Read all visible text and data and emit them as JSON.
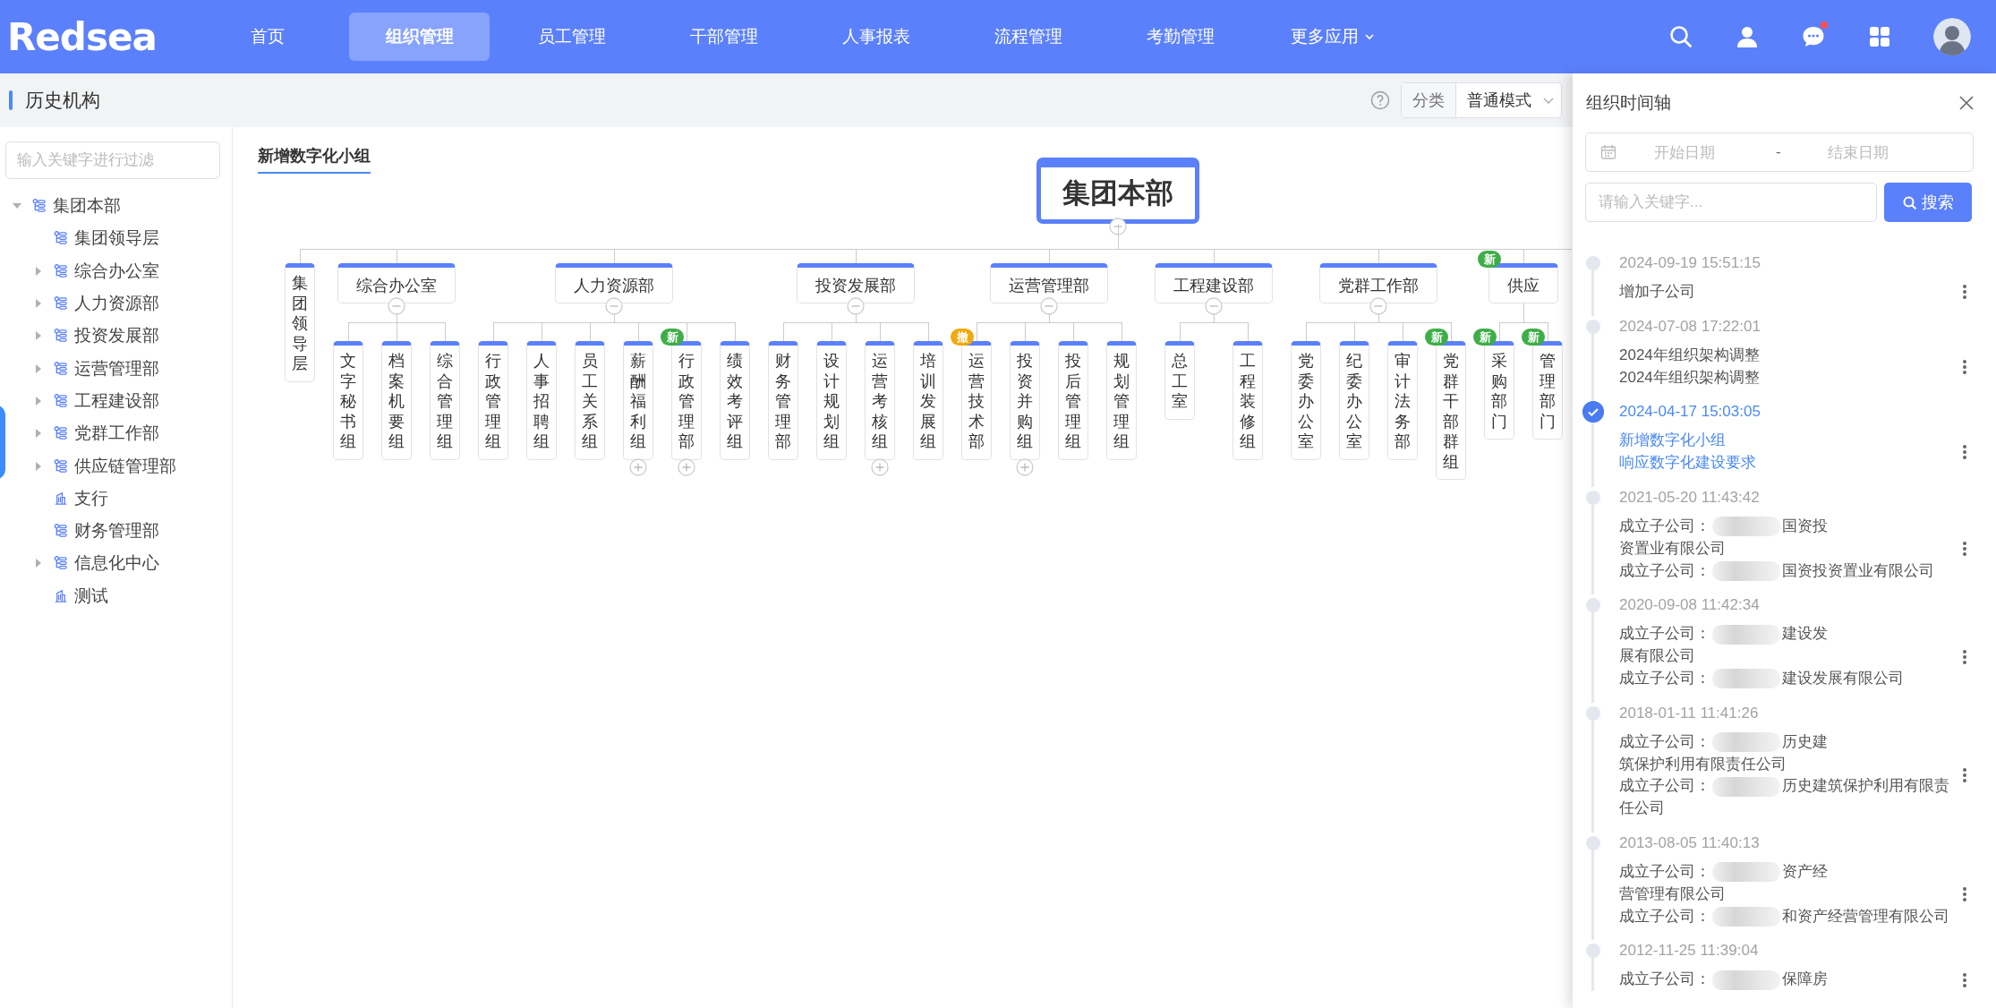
{
  "header": {
    "logo": "Redsea",
    "nav": [
      {
        "label": "首页",
        "selected": false,
        "has_menu": false
      },
      {
        "label": "组织管理",
        "selected": true,
        "has_menu": false
      },
      {
        "label": "员工管理",
        "selected": false,
        "has_menu": false
      },
      {
        "label": "干部管理",
        "selected": false,
        "has_menu": false
      },
      {
        "label": "人事报表",
        "selected": false,
        "has_menu": false
      },
      {
        "label": "流程管理",
        "selected": false,
        "has_menu": false
      },
      {
        "label": "考勤管理",
        "selected": false,
        "has_menu": false
      },
      {
        "label": "更多应用",
        "selected": false,
        "has_menu": true
      }
    ],
    "chat_unread": true
  },
  "page_title": "历史机构",
  "category": {
    "label": "分类",
    "value": "普通模式"
  },
  "sidebar": {
    "filter_placeholder": "输入关键字进行过滤",
    "tree": [
      {
        "label": "集团本部",
        "kind": "org",
        "expandable": true,
        "expanded": true,
        "children": [
          {
            "label": "集团领导层",
            "kind": "org",
            "expandable": false
          },
          {
            "label": "综合办公室",
            "kind": "org",
            "expandable": true,
            "expanded": false
          },
          {
            "label": "人力资源部",
            "kind": "org",
            "expandable": true,
            "expanded": false
          },
          {
            "label": "投资发展部",
            "kind": "org",
            "expandable": true,
            "expanded": false
          },
          {
            "label": "运营管理部",
            "kind": "org",
            "expandable": true,
            "expanded": false
          },
          {
            "label": "工程建设部",
            "kind": "org",
            "expandable": true,
            "expanded": false
          },
          {
            "label": "党群工作部",
            "kind": "org",
            "expandable": true,
            "expanded": false
          },
          {
            "label": "供应链管理部",
            "kind": "org",
            "expandable": true,
            "expanded": false
          },
          {
            "label": "支行",
            "kind": "branch",
            "expandable": false
          },
          {
            "label": "财务管理部",
            "kind": "org",
            "expandable": false
          },
          {
            "label": "信息化中心",
            "kind": "org",
            "expandable": true,
            "expanded": false
          },
          {
            "label": "测试",
            "kind": "branch",
            "expandable": false
          }
        ]
      }
    ]
  },
  "chart": {
    "title": "新增数字化小组",
    "root": {
      "label": "集团本部",
      "expandable": true,
      "expanded": true,
      "children": [
        {
          "label": "集团领导层",
          "expandable": false,
          "expanded": false
        },
        {
          "label": "综合办公室",
          "expandable": true,
          "expanded": true,
          "children": [
            {
              "label": "文字秘书组",
              "expandable": false,
              "expanded": false
            },
            {
              "label": "档案机要组",
              "expandable": false,
              "expanded": false
            },
            {
              "label": "综合管理组",
              "expandable": false,
              "expanded": false
            }
          ]
        },
        {
          "label": "人力资源部",
          "expandable": true,
          "expanded": true,
          "children": [
            {
              "label": "行政管理组",
              "expandable": false,
              "expanded": false
            },
            {
              "label": "人事招聘组",
              "expandable": false,
              "expanded": false
            },
            {
              "label": "员工关系组",
              "expandable": false,
              "expanded": false
            },
            {
              "label": "薪酬福利组",
              "expandable": true,
              "expanded": false
            },
            {
              "label": "行政管理部",
              "expandable": true,
              "expanded": false,
              "badge": {
                "text": "新",
                "kind": "new"
              }
            },
            {
              "label": "绩效考评组",
              "expandable": false,
              "expanded": false
            }
          ]
        },
        {
          "label": "投资发展部",
          "expandable": true,
          "expanded": true,
          "children": [
            {
              "label": "财务管理部",
              "expandable": false,
              "expanded": false
            },
            {
              "label": "设计规划组",
              "expandable": false,
              "expanded": false
            },
            {
              "label": "运营考核组",
              "expandable": true,
              "expanded": false
            },
            {
              "label": "培训发展组",
              "expandable": false,
              "expanded": false
            }
          ]
        },
        {
          "label": "运营管理部",
          "expandable": true,
          "expanded": true,
          "children": [
            {
              "label": "运营技术部",
              "expandable": false,
              "expanded": false,
              "badge": {
                "text": "撤",
                "kind": "revoked"
              }
            },
            {
              "label": "投资并购组",
              "expandable": true,
              "expanded": false
            },
            {
              "label": "投后管理组",
              "expandable": false,
              "expanded": false
            },
            {
              "label": "规划管理组",
              "expandable": false,
              "expanded": false
            }
          ]
        },
        {
          "label": "工程建设部",
          "expandable": true,
          "expanded": true,
          "children": [
            {
              "label": "总工室",
              "expandable": false,
              "expanded": false
            },
            {
              "label": "工程装修组",
              "expandable": false,
              "expanded": false
            }
          ]
        },
        {
          "label": "党群工作部",
          "expandable": true,
          "expanded": true,
          "children": [
            {
              "label": "党委办公室",
              "expandable": false,
              "expanded": false
            },
            {
              "label": "纪委办公室",
              "expandable": false,
              "expanded": false
            },
            {
              "label": "审计法务部",
              "expandable": false,
              "expanded": false
            },
            {
              "label": "党群干部群组",
              "expandable": false,
              "expanded": false,
              "badge": {
                "text": "新",
                "kind": "new"
              }
            }
          ]
        },
        {
          "label": "供应",
          "expandable": false,
          "expanded": true,
          "badge": {
            "text": "新",
            "kind": "new"
          },
          "children": [
            {
              "label": "采购部门",
              "expandable": false,
              "expanded": false,
              "badge": {
                "text": "新",
                "kind": "new"
              }
            },
            {
              "label": "管理部门",
              "expandable": false,
              "expanded": false,
              "badge": {
                "text": "新",
                "kind": "new"
              }
            }
          ]
        }
      ]
    }
  },
  "timeline_panel": {
    "title": "组织时间轴",
    "date_range": {
      "start_placeholder": "开始日期",
      "separator": "-",
      "end_placeholder": "结束日期"
    },
    "keyword_placeholder": "请输入关键字...",
    "search_button": "搜索",
    "entries": [
      {
        "date": "2024-09-19 15:51:15",
        "selected": false,
        "lines": [
          {
            "text": "增加子公司",
            "redacted": false
          }
        ]
      },
      {
        "date": "2024-07-08 17:22:01",
        "selected": false,
        "lines": [
          {
            "text": "2024年组织架构调整",
            "redacted": false
          },
          {
            "text": "2024年组织架构调整",
            "redacted": false
          }
        ]
      },
      {
        "date": "2024-04-17 15:03:05",
        "selected": true,
        "lines": [
          {
            "text": "新增数字化小组",
            "redacted": false
          },
          {
            "text": "响应数字化建设要求",
            "redacted": false
          }
        ]
      },
      {
        "date": "2021-05-20 11:43:42",
        "selected": false,
        "lines": [
          {
            "text": "成立子公司：",
            "redacted": true,
            "after": "国资投"
          },
          {
            "text": "资置业有限公司",
            "redacted": false
          },
          {
            "text": "成立子公司：",
            "redacted": true,
            "after": "国资投资置业有限公司"
          }
        ]
      },
      {
        "date": "2020-09-08 11:42:34",
        "selected": false,
        "lines": [
          {
            "text": "成立子公司：",
            "redacted": true,
            "after": "建设发"
          },
          {
            "text": "展有限公司",
            "redacted": false
          },
          {
            "text": "成立子公司：",
            "redacted": true,
            "after": "建设发展有限公司"
          }
        ]
      },
      {
        "date": "2018-01-11 11:41:26",
        "selected": false,
        "lines": [
          {
            "text": "成立子公司：",
            "redacted": true,
            "after": "历史建"
          },
          {
            "text": "筑保护利用有限责任公司",
            "redacted": false
          },
          {
            "text": "成立子公司：",
            "redacted": true,
            "after": "历史建筑保护利用有限责"
          },
          {
            "text": "任公司",
            "redacted": false
          }
        ]
      },
      {
        "date": "2013-08-05 11:40:13",
        "selected": false,
        "lines": [
          {
            "text": "成立子公司：",
            "redacted": true,
            "after": "资产经"
          },
          {
            "text": "营管理有限公司",
            "redacted": false
          },
          {
            "text": "成立子公司：",
            "redacted": true,
            "after": "和资产经营管理有限公司"
          }
        ]
      },
      {
        "date": "2012-11-25 11:39:04",
        "selected": false,
        "lines": [
          {
            "text": "成立子公司：",
            "redacted": true,
            "after": "保障房"
          }
        ]
      }
    ]
  }
}
